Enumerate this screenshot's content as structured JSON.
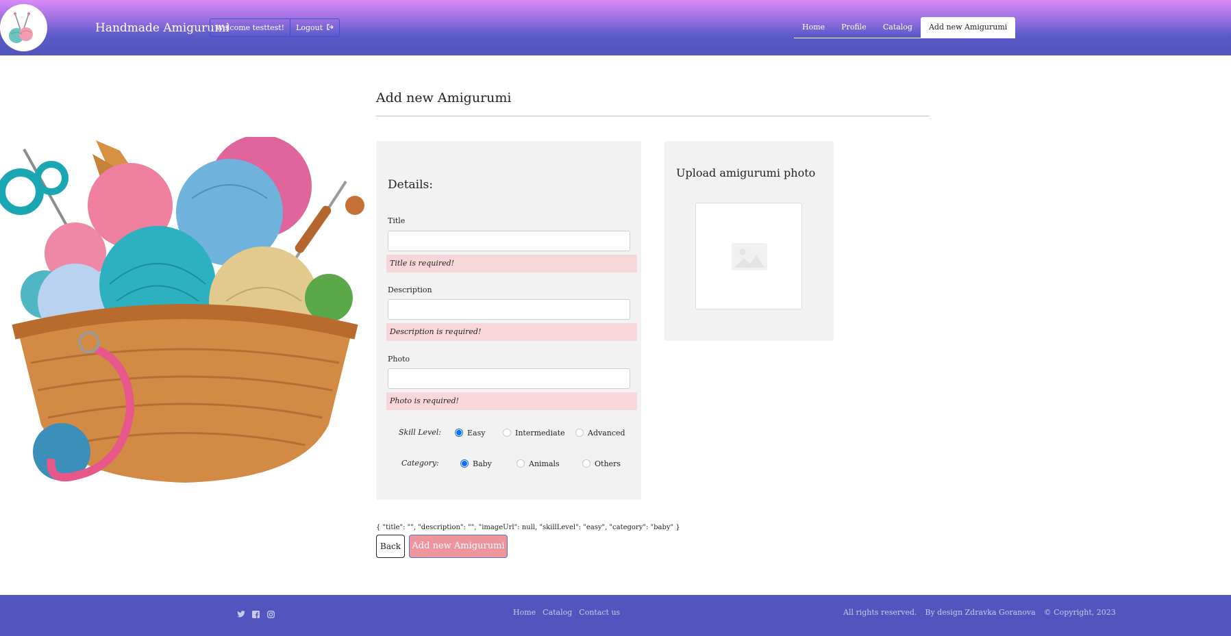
{
  "header": {
    "brand": "Handmade Amigurumi",
    "welcome_label": "Welcome testtest!",
    "logout_label": "Logout",
    "nav": [
      "Home",
      "Profile",
      "Catalog",
      "Add new Amigurumi"
    ],
    "active_tab": "Add new Amigurumi"
  },
  "main": {
    "title": "Add new Amigurumi",
    "details": {
      "heading": "Details:",
      "title_label": "Title",
      "title_value": "",
      "title_error": "Title is required!",
      "description_label": "Description",
      "description_value": "",
      "description_error": "Description is required!",
      "photo_label": "Photo",
      "photo_value": "",
      "photo_error": "Photo is required!",
      "skill": {
        "label": "Skill Level:",
        "options": [
          "Easy",
          "Intermediate",
          "Advanced"
        ],
        "selected": "Easy"
      },
      "category": {
        "label": "Category:",
        "options": [
          "Baby",
          "Animals",
          "Others"
        ],
        "selected": "Baby"
      }
    },
    "upload": {
      "heading": "Upload amigurumi photo",
      "icon": "image-placeholder-icon"
    },
    "json_preview": "{ \"title\": \"\", \"description\": \"\", \"imageUrl\": null, \"skillLevel\": \"easy\", \"category\": \"baby\" }",
    "back_label": "Back",
    "submit_label": "Add new Amigurumi"
  },
  "footer": {
    "socials": [
      "twitter-icon",
      "facebook-icon",
      "instagram-icon"
    ],
    "links": [
      "Home",
      "Catalog",
      "Contact us"
    ],
    "rights": "All rights reserved.",
    "designer": "By design Zdravka Goranova",
    "copyright": "© Copyright, 2023"
  },
  "colors": {
    "header_top": "#d98af7",
    "header_bottom": "#5155bd",
    "error_bg": "#f8d7da",
    "submit_bg": "#ee949c",
    "radio_accent": "#0d6efd",
    "footer_bg": "#5155bd"
  }
}
